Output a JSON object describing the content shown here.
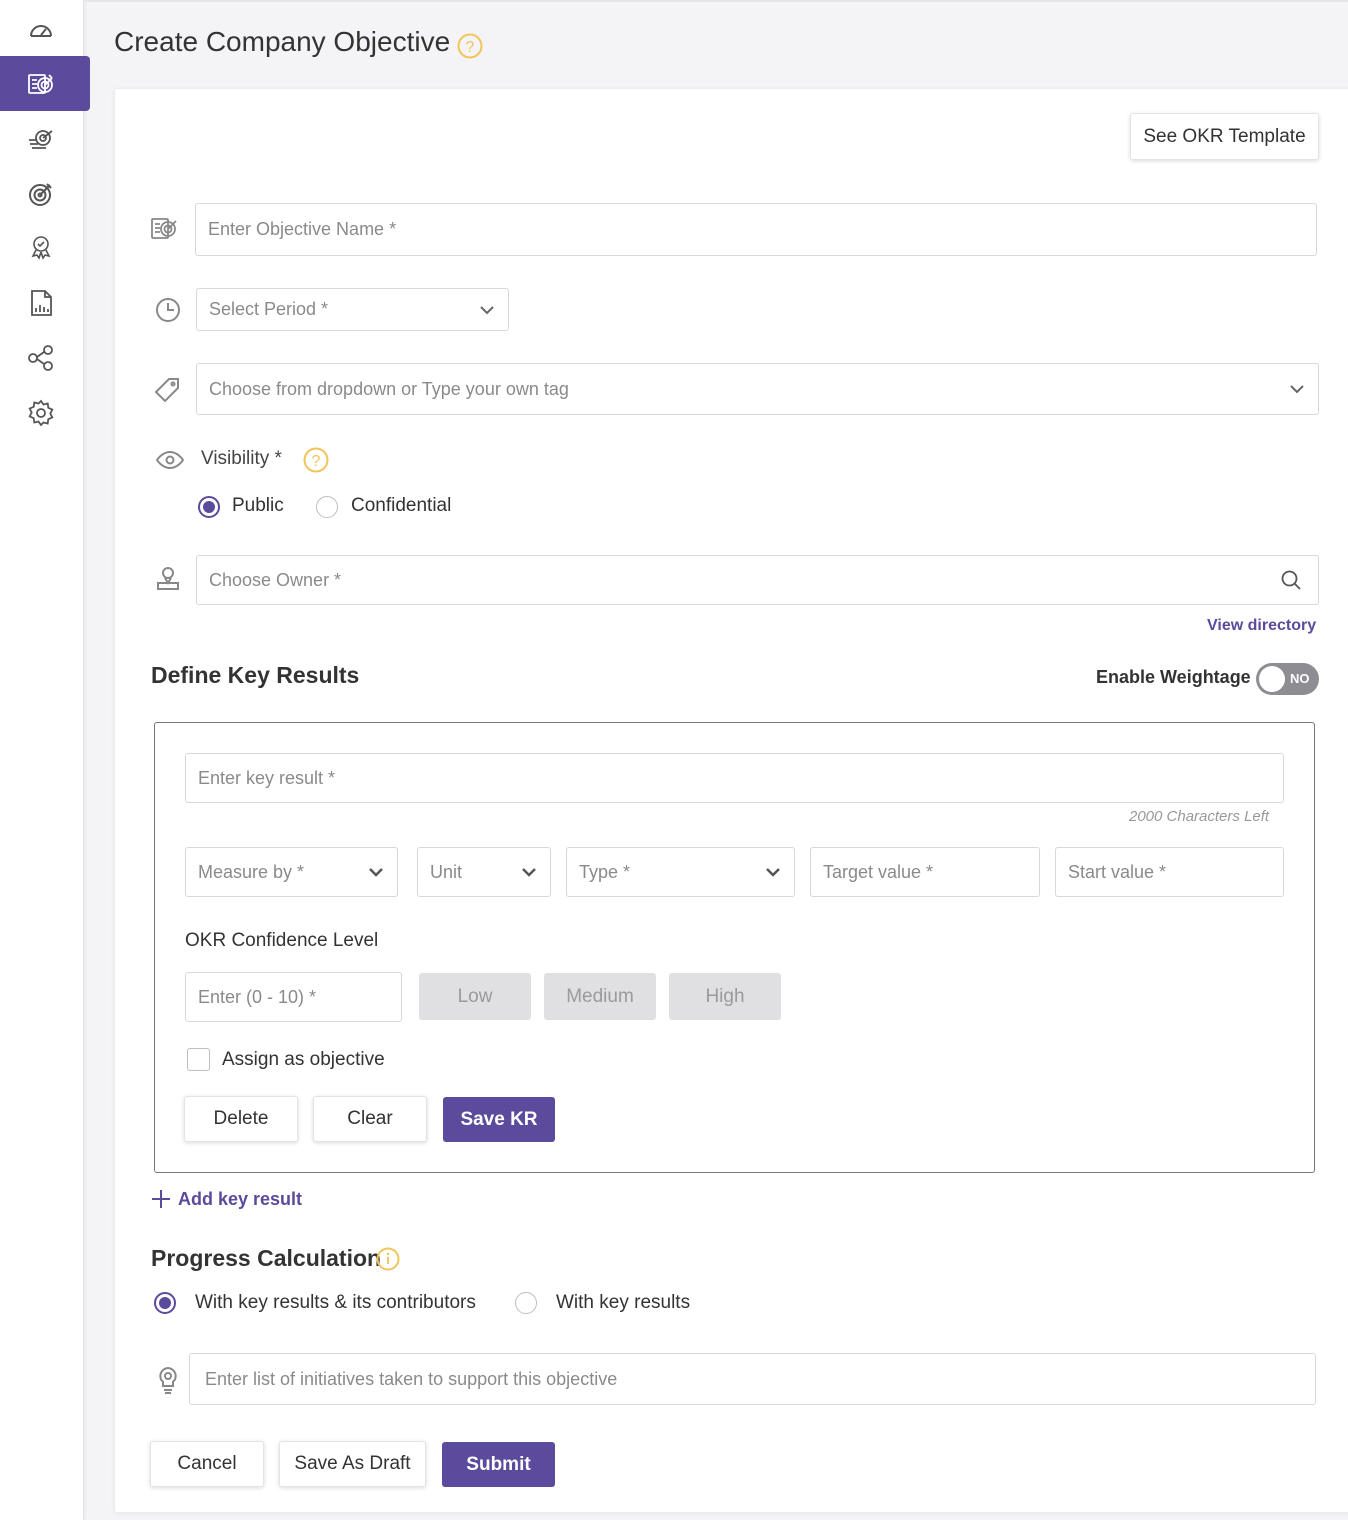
{
  "page": {
    "title": "Create Company Objective"
  },
  "sidebar": {
    "items": [
      {
        "icon": "dashboard-icon",
        "active": false
      },
      {
        "icon": "objective-icon",
        "active": true
      },
      {
        "icon": "team-objectives-icon",
        "active": false
      },
      {
        "icon": "target-icon",
        "active": false
      },
      {
        "icon": "awards-icon",
        "active": false
      },
      {
        "icon": "report-icon",
        "active": false
      },
      {
        "icon": "alignment-icon",
        "active": false
      },
      {
        "icon": "settings-icon",
        "active": false
      }
    ]
  },
  "toolbar": {
    "template_label": "See OKR Template"
  },
  "objective": {
    "name_placeholder": "Enter Objective Name *",
    "period_placeholder": "Select Period *",
    "tag_placeholder": "Choose from dropdown or Type your own tag",
    "visibility_label": "Visibility *",
    "visibility_options": [
      "Public",
      "Confidential"
    ],
    "visibility_selected": "Public",
    "owner_placeholder": "Choose Owner *",
    "view_directory": "View directory"
  },
  "key_results": {
    "heading": "Define Key Results",
    "weightage_label": "Enable Weightage",
    "weightage_toggle": "NO",
    "kr_placeholder": "Enter key result *",
    "chars_left": "2000 Characters Left",
    "measure_by": "Measure by *",
    "unit": "Unit",
    "type": "Type *",
    "target_value": "Target value *",
    "start_value": "Start value *",
    "confidence_label": "OKR Confidence Level",
    "confidence_placeholder": "Enter (0 - 10) *",
    "confidence_levels": [
      "Low",
      "Medium",
      "High"
    ],
    "assign_label": "Assign as objective",
    "delete_label": "Delete",
    "clear_label": "Clear",
    "save_label": "Save KR",
    "add_label": "Add key result"
  },
  "progress": {
    "heading": "Progress Calculation",
    "options": [
      "With key results & its contributors",
      "With key results"
    ],
    "selected": "With key results & its contributors"
  },
  "initiatives": {
    "placeholder": "Enter list of initiatives taken to support this objective"
  },
  "footer": {
    "cancel_label": "Cancel",
    "draft_label": "Save As Draft",
    "submit_label": "Submit"
  },
  "colors": {
    "accent": "#5c4a9c",
    "help": "#f2c45a",
    "border": "#d8d8dc"
  }
}
